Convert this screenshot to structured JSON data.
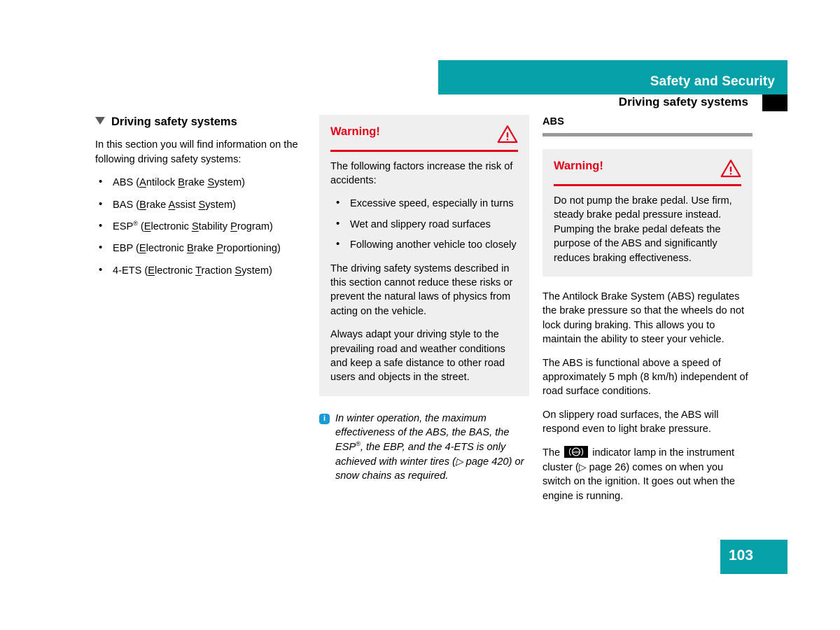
{
  "header": {
    "title": "Safety and Security",
    "subtitle": "Driving safety systems"
  },
  "left_column": {
    "heading": "Driving safety systems",
    "intro": "In this section you will find information on the following driving safety systems:",
    "systems": [
      {
        "abbr": "ABS",
        "parts": [
          [
            "A",
            "ntilock"
          ],
          [
            "B",
            "rake"
          ],
          [
            "S",
            "ystem"
          ]
        ]
      },
      {
        "abbr": "BAS",
        "parts": [
          [
            "B",
            "rake"
          ],
          [
            "A",
            "ssist"
          ],
          [
            "S",
            "ystem"
          ]
        ]
      },
      {
        "abbr": "ESP",
        "registered": true,
        "parts": [
          [
            "E",
            "lectronic"
          ],
          [
            "S",
            "tability"
          ],
          [
            "P",
            "rogram"
          ]
        ]
      },
      {
        "abbr": "EBP",
        "parts": [
          [
            "E",
            "lectronic"
          ],
          [
            "B",
            "rake"
          ],
          [
            "P",
            "roportioning"
          ]
        ]
      },
      {
        "abbr": "4-ETS",
        "parts": [
          [
            "E",
            "lectronic"
          ],
          [
            "T",
            "raction"
          ],
          [
            "S",
            "ystem"
          ]
        ]
      }
    ]
  },
  "middle_column": {
    "warning": {
      "title": "Warning!",
      "intro": "The following factors increase the risk of accidents:",
      "factors": [
        "Excessive speed, especially in turns",
        "Wet and slippery road surfaces",
        "Following another vehicle too closely"
      ],
      "paragraphs": [
        "The driving safety systems described in this section cannot reduce these risks or prevent the natural laws of physics from acting on the vehicle.",
        "Always adapt your driving style to the prevailing road and weather conditions and keep a safe distance to other road users and objects in the street."
      ]
    },
    "note": {
      "text_before": "In winter operation, the maximum effectiveness of the ABS, the BAS, the ESP",
      "registered": "®",
      "text_middle": ", the EBP, and the 4-ETS is only achieved with winter tires (",
      "xref_arrow": "▷",
      "xref": " page 420",
      "text_after": ") or snow chains as required."
    }
  },
  "right_column": {
    "heading": "ABS",
    "warning": {
      "title": "Warning!",
      "body": "Do not pump the brake pedal. Use firm, steady brake pedal pressure instead. Pumping the brake pedal defeats the purpose of the ABS and significantly reduces braking effectiveness."
    },
    "paragraphs": [
      "The Antilock Brake System (ABS) regulates the brake pressure so that the wheels do not lock during braking. This allows you to maintain the ability to steer your vehicle.",
      "The ABS is functional above a speed of approximately 5 mph (8 km/h) independent of road surface conditions.",
      "On slippery road surfaces, the ABS will respond even to light brake pressure."
    ],
    "lamp_paragraph": {
      "text_before": "The ",
      "lamp_label": "ABS",
      "text_middle": " indicator lamp in the instrument cluster (",
      "xref_arrow": "▷",
      "xref": " page 26",
      "text_after": ") comes on when you switch on the ignition. It goes out when the engine is running."
    }
  },
  "footer": {
    "page_number": "103"
  },
  "colors": {
    "teal": "#05A0A8",
    "warning_red": "#E2001A",
    "box_gray": "#EFEFEF",
    "rule_gray": "#9A9A9A",
    "info_blue": "#1A9BD7"
  }
}
